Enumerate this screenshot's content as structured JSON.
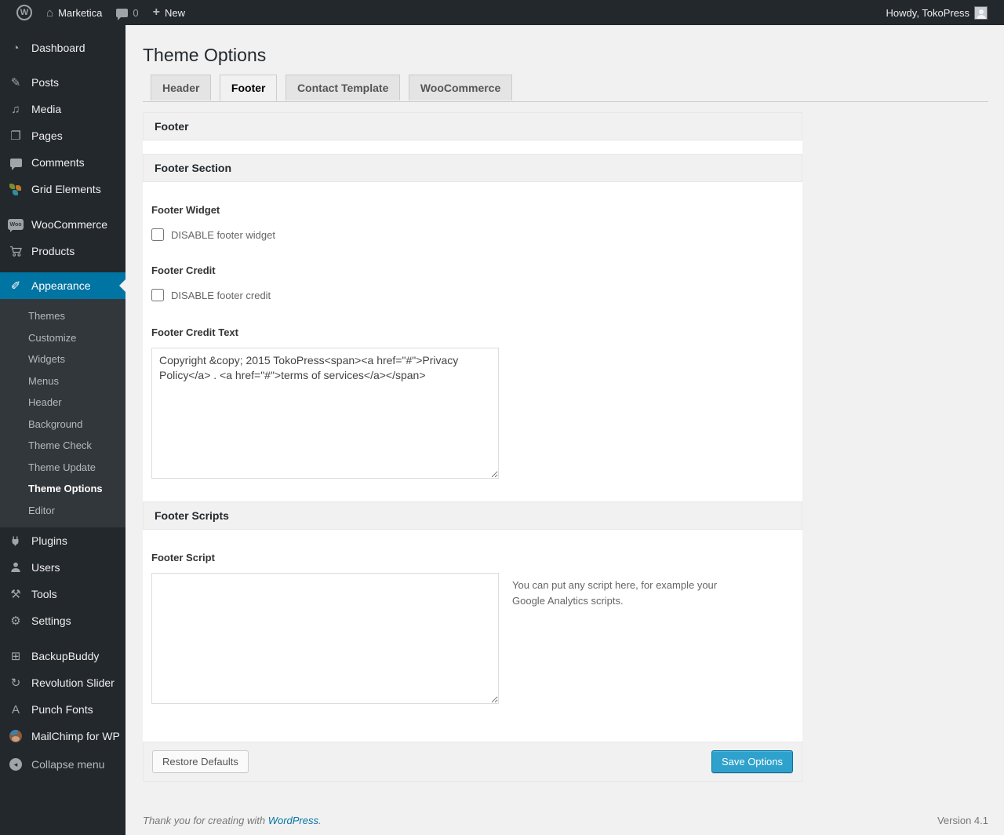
{
  "colors": {
    "accent": "#0074a2",
    "button_primary": "#2ea2cc",
    "admin_bar_bg": "#23282d",
    "submenu_bg": "#32373c",
    "page_bg": "#f1f1f1"
  },
  "admin_bar": {
    "site_name": "Marketica",
    "comment_count": "0",
    "new_label": "New",
    "howdy": "Howdy, TokoPress"
  },
  "icons": {
    "wp_logo": "W",
    "home": "⌂",
    "plus": "+",
    "dashboard": "◔",
    "posts": "✎",
    "media": "♫",
    "pages": "❐",
    "appearance": "✐",
    "tools": "⚒",
    "settings": "⚙",
    "backupbuddy": "⊞",
    "revolution_slider": "↻",
    "punch_fonts": "A",
    "collapse_arrow": "◂",
    "woo_badge": "Woo"
  },
  "sidebar": {
    "items": [
      {
        "label": "Dashboard"
      },
      {
        "label": "Posts"
      },
      {
        "label": "Media"
      },
      {
        "label": "Pages"
      },
      {
        "label": "Comments"
      },
      {
        "label": "Grid Elements"
      },
      {
        "label": "WooCommerce"
      },
      {
        "label": "Products"
      },
      {
        "label": "Appearance"
      },
      {
        "label": "Plugins"
      },
      {
        "label": "Users"
      },
      {
        "label": "Tools"
      },
      {
        "label": "Settings"
      },
      {
        "label": "BackupBuddy"
      },
      {
        "label": "Revolution Slider"
      },
      {
        "label": "Punch Fonts"
      },
      {
        "label": "MailChimp for WP"
      }
    ],
    "appearance_submenu": [
      "Themes",
      "Customize",
      "Widgets",
      "Menus",
      "Header",
      "Background",
      "Theme Check",
      "Theme Update",
      "Theme Options",
      "Editor"
    ],
    "collapse_label": "Collapse menu"
  },
  "page": {
    "title": "Theme Options",
    "tabs": [
      {
        "label": "Header",
        "active": false
      },
      {
        "label": "Footer",
        "active": true
      },
      {
        "label": "Contact Template",
        "active": false
      },
      {
        "label": "WooCommerce",
        "active": false
      }
    ],
    "panel_title": "Footer",
    "section1": {
      "title": "Footer Section",
      "footer_widget_label": "Footer Widget",
      "footer_widget_checkbox": "DISABLE footer widget",
      "footer_credit_label": "Footer Credit",
      "footer_credit_checkbox": "DISABLE footer credit",
      "footer_credit_text_label": "Footer Credit Text",
      "footer_credit_text_value": "Copyright &copy; 2015 TokoPress<span><a href=\"#\">Privacy Policy</a> . <a href=\"#\">terms of services</a></span>"
    },
    "section2": {
      "title": "Footer Scripts",
      "footer_script_label": "Footer Script",
      "footer_script_value": "",
      "footer_script_hint": "You can put any script here, for example your Google Analytics scripts."
    },
    "buttons": {
      "restore": "Restore Defaults",
      "save": "Save Options"
    }
  },
  "footer": {
    "thanks_prefix": "Thank you for creating with ",
    "wordpress_link": "WordPress",
    "thanks_suffix": ".",
    "version": "Version 4.1"
  }
}
